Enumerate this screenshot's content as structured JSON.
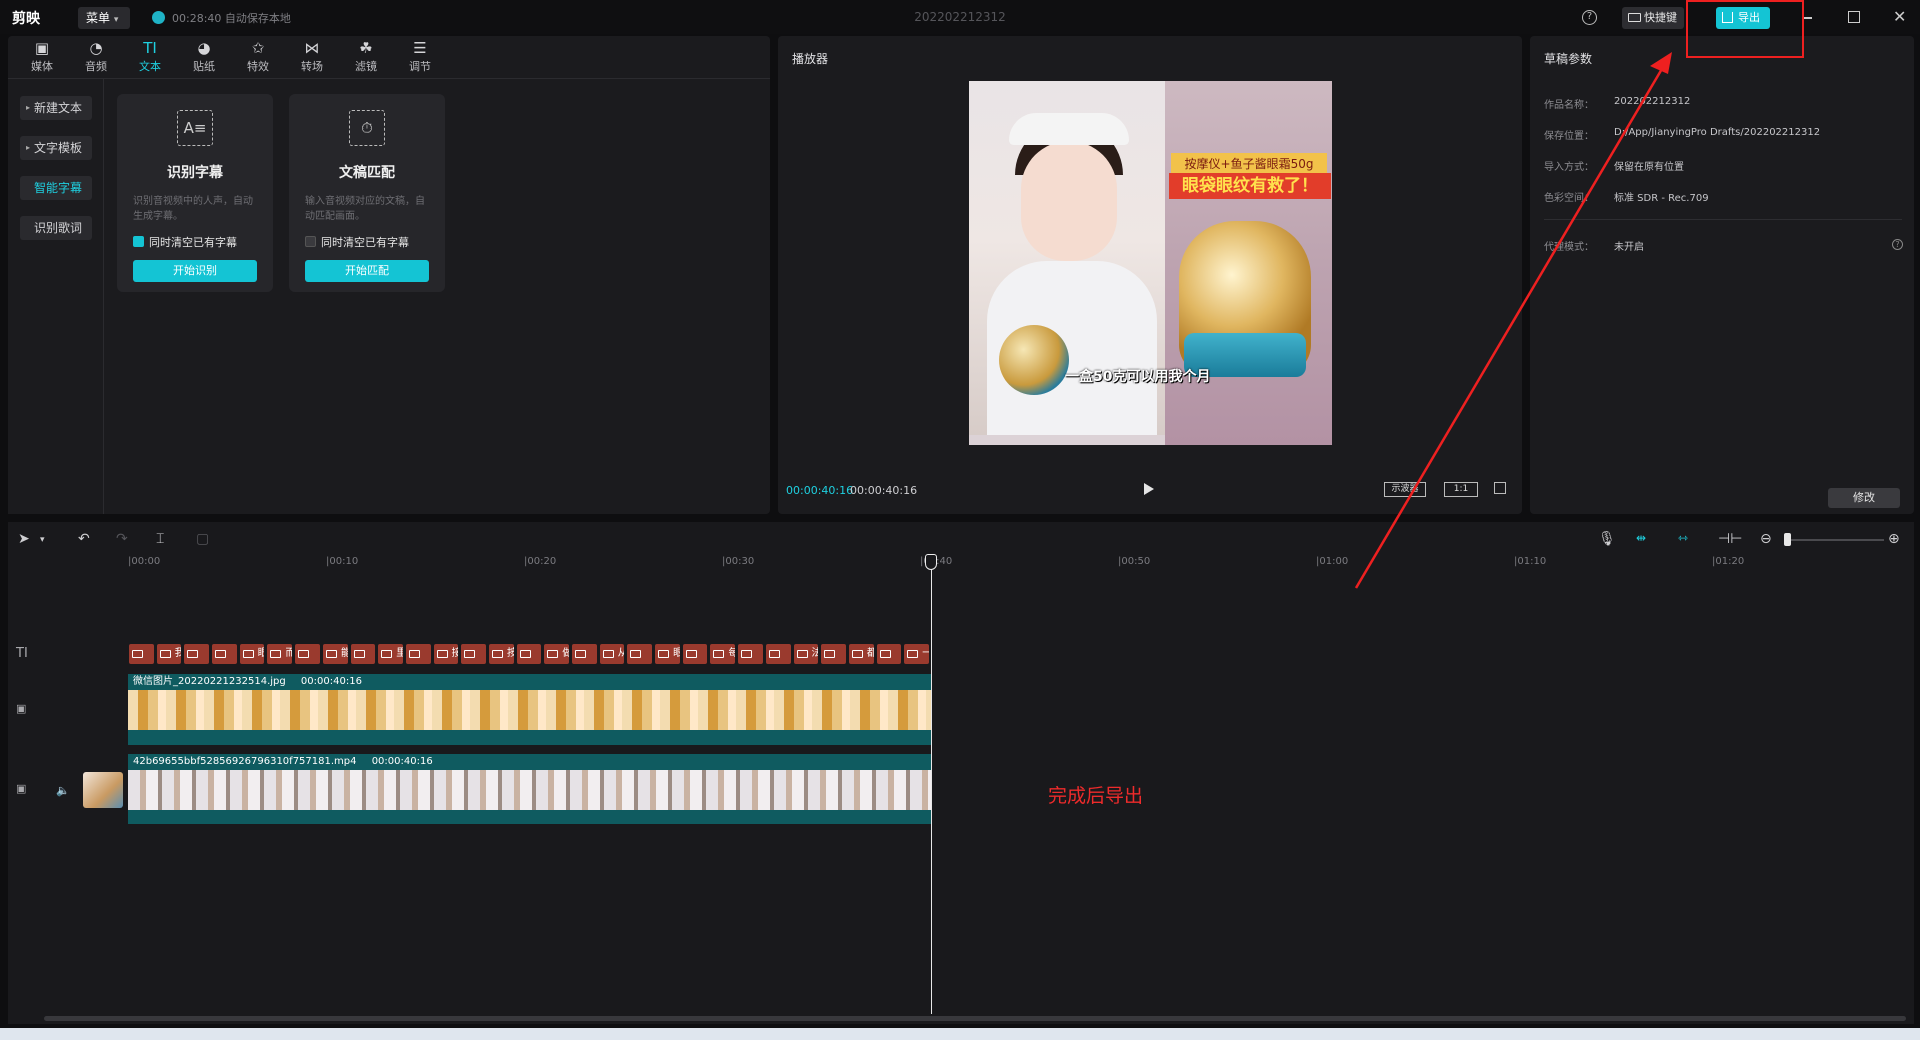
{
  "app": {
    "logo": "剪映",
    "menu_label": "菜单",
    "save_status": "00:28:40 自动保存本地",
    "doc_title": "202202212312",
    "shortcut_label": "快捷键",
    "export_label": "导出"
  },
  "toolbar": {
    "tabs": [
      {
        "label": "媒体",
        "icon": "media-icon"
      },
      {
        "label": "音频",
        "icon": "audio-icon"
      },
      {
        "label": "文本",
        "icon": "text-icon"
      },
      {
        "label": "贴纸",
        "icon": "sticker-icon"
      },
      {
        "label": "特效",
        "icon": "effects-icon"
      },
      {
        "label": "转场",
        "icon": "transition-icon"
      },
      {
        "label": "滤镜",
        "icon": "filter-icon"
      },
      {
        "label": "调节",
        "icon": "adjust-icon"
      }
    ],
    "active_tab": "文本"
  },
  "sidebar": {
    "items": [
      {
        "label": "新建文本"
      },
      {
        "label": "文字模板"
      },
      {
        "label": "智能字幕"
      },
      {
        "label": "识别歌词"
      }
    ]
  },
  "cards": [
    {
      "title": "识别字幕",
      "desc": "识别音视频中的人声，自动生成字幕。",
      "check_label": "同时清空已有字幕",
      "checked": true,
      "button": "开始识别"
    },
    {
      "title": "文稿匹配",
      "desc": "输入音视频对应的文稿，自动匹配画面。",
      "check_label": "同时清空已有字幕",
      "checked": false,
      "button": "开始匹配"
    }
  ],
  "player": {
    "title": "播放器",
    "current_time": "00:00:40:16",
    "total_time": "00:00:40:16",
    "scope_label": "示波器",
    "ratio_label": "1:1",
    "banner_top": "按摩仪+鱼子酱眼霜50g",
    "banner_main": "眼袋眼纹有救了！",
    "caption": "一盒50克可以用我个月"
  },
  "params": {
    "title": "草稿参数",
    "rows": [
      {
        "label": "作品名称：",
        "value": "202202212312"
      },
      {
        "label": "保存位置：",
        "value": "D:/App/JianyingPro Drafts/202202212312"
      },
      {
        "label": "导入方式：",
        "value": "保留在原有位置"
      },
      {
        "label": "色彩空间：",
        "value": "标准 SDR - Rec.709"
      }
    ],
    "proxy_label": "代理模式：",
    "proxy_value": "未开启",
    "modify_label": "修改"
  },
  "timeline": {
    "ticks": [
      "|00:00",
      "|00:10",
      "|00:20",
      "|00:30",
      "|00:40",
      "|00:50",
      "|01:00",
      "|01:10",
      "|01:20"
    ],
    "text_clips": [
      "",
      "我的",
      "",
      "",
      "眼袋",
      "而",
      "",
      "能让眼",
      "",
      "里面",
      "",
      "接",
      "",
      "按",
      "",
      "做提拉",
      "",
      "从",
      "",
      "眼部品",
      "",
      "每",
      "",
      "",
      "法",
      "",
      "都可以",
      "",
      "一盒"
    ],
    "image_clip": {
      "name": "微信图片_20220221232514.jpg",
      "duration": "00:00:40:16"
    },
    "video_clip": {
      "name": "42b69655bbf52856926796310f757181.mp4",
      "duration": "00:00:40:16"
    }
  },
  "annotation": "完成后导出",
  "colors": {
    "accent": "#14c4d4",
    "annotation_red": "#ee2020",
    "clip_teal": "#0f5b60",
    "text_clip_red": "#9a3a2e"
  }
}
